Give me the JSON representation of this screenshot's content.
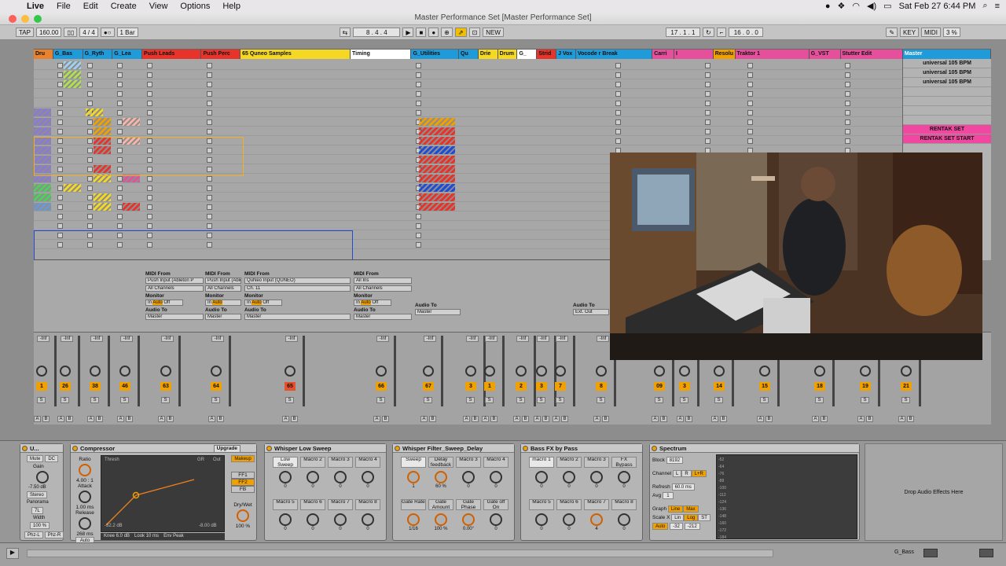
{
  "menubar": {
    "app": "Live",
    "items": [
      "File",
      "Edit",
      "Create",
      "View",
      "Options",
      "Help"
    ],
    "clock": "Sat Feb 27  6:44 PM"
  },
  "window": {
    "title": "Master Performance Set  [Master Performance Set]"
  },
  "transport": {
    "tap": "TAP",
    "tempo": "160.00",
    "signature": "4 / 4",
    "quant": "1 Bar",
    "position": "8 .  4 .  4",
    "new": "NEW",
    "loop_start": "17 .  1 .  1",
    "loop_len": "16 .  0 .  0",
    "key": "KEY",
    "midi": "MIDI",
    "cpu": "3 %"
  },
  "tracks": [
    {
      "name": "Dru",
      "color": "#e9822f"
    },
    {
      "name": "G_Bas",
      "color": "#1e9bd8"
    },
    {
      "name": "G_Ryth",
      "color": "#1e9bd8"
    },
    {
      "name": "G_Lea",
      "color": "#1e9bd8"
    },
    {
      "name": "Push Leads",
      "color": "#e8332b"
    },
    {
      "name": "Push Perc",
      "color": "#e8332b"
    },
    {
      "name": "65 Quneo Samples",
      "color": "#f4d823"
    },
    {
      "name": "Timing",
      "color": "#ffffff"
    },
    {
      "name": "G_Utilities",
      "color": "#1e9bd8"
    },
    {
      "name": "Qu",
      "color": "#1e9bd8"
    },
    {
      "name": "Drie",
      "color": "#f4d823"
    },
    {
      "name": "Drum",
      "color": "#f4d823"
    },
    {
      "name": "G_",
      "color": "#ffffff"
    },
    {
      "name": "Strid",
      "color": "#e8332b"
    },
    {
      "name": "J Vox",
      "color": "#1e9bd8"
    },
    {
      "name": "Vocode r Break",
      "color": "#1e9bd8"
    },
    {
      "name": "Carri",
      "color": "#e64f9c"
    },
    {
      "name": "I",
      "color": "#e64f9c"
    },
    {
      "name": "Resolu",
      "color": "#f0a000"
    },
    {
      "name": "Traktor 1",
      "color": "#e64f9c"
    },
    {
      "name": "G_VST",
      "color": "#e64f9c"
    },
    {
      "name": "Stutter Edit",
      "color": "#e64f9c"
    },
    {
      "name": "Master",
      "color": "#1e9bd8"
    }
  ],
  "master_scenes": [
    "universal 105 BPM",
    "universal 105 BPM",
    "universal 105 BPM",
    "",
    "",
    "",
    "",
    "RENTAK SET",
    "RENTAK SET START"
  ],
  "io": {
    "midi_from": "MIDI From",
    "audio_to": "Audio To",
    "monitor": "Monitor",
    "master": "Master",
    "in": "In",
    "auto": "Auto",
    "off": "Off",
    "push_input": "Push Input (Ableton P",
    "all_channels": "All Channels",
    "quneo_input": "QuNeo Input (QUNEO)",
    "ch11": "Ch. 11",
    "all_ins": "All Ins",
    "ext_out": "Ext. Out"
  },
  "mixer": {
    "numbers": [
      "1",
      "26",
      "38",
      "46",
      "63",
      "64",
      "65",
      "66",
      "67",
      "3",
      "1",
      "2",
      "3",
      "7",
      "8",
      "09",
      "3",
      "14",
      "15",
      "18",
      "19",
      "21"
    ],
    "solo": "S",
    "ab_a": "A",
    "ab_b": "B"
  },
  "devices": {
    "utility": {
      "title": "U...",
      "mute": "Mute",
      "dc": "DC",
      "gain": "Gain",
      "gain_val": "-7.50 dB",
      "stereo": "Stereo",
      "panorama": "Panorama",
      "pan_val": "7L",
      "width": "Width",
      "width_val": "100 %",
      "phzl": "Phz-L",
      "phzr": "Phz-R"
    },
    "compressor": {
      "title": "Compressor",
      "upgrade": "Upgrade",
      "makeup": "Makeup",
      "ratio": "Ratio",
      "ratio_val": "4.00 : 1",
      "attack": "Attack",
      "attack_val": "1.00 ms",
      "release": "Release",
      "release_val": "268 ms",
      "auto": "Auto",
      "thresh": "Thresh",
      "gr": "GR",
      "out": "Out",
      "left_db": "-32.2 dB",
      "right_db": "-8.00 dB",
      "knee": "Knee 6.0 dB",
      "look": "Look 10 ms",
      "env": "Env Peak",
      "ff1": "FF1",
      "ff2": "FF2",
      "fb": "FB",
      "drywet": "Dry/Wet",
      "drywet_val": "100 %"
    },
    "whisper_low": {
      "title": "Whisper Low Sweep",
      "macros": [
        "Low Sweep",
        "Macro 2",
        "Macro 3",
        "Macro 4",
        "Macro 5",
        "Macro 6",
        "Macro 7",
        "Macro 8"
      ],
      "values": [
        "0",
        "0",
        "0",
        "0",
        "0",
        "0",
        "0",
        "0"
      ]
    },
    "whisper_filter": {
      "title": "Whisper Filter_Sweep_Delay",
      "macros": [
        "Sweep",
        "Delay feedback",
        "Macro 3",
        "Macro 4",
        "Gate Rate",
        "Gate Amount",
        "Gate Phase",
        "Gate off On"
      ],
      "values": [
        "1",
        "60 %",
        "0",
        "0",
        "1/16",
        "100 %",
        "0.00°",
        "0"
      ]
    },
    "bass_fx": {
      "title": "Bass FX by Pass",
      "macros": [
        "macro 1",
        "Macro 2",
        "Macro 3",
        "FX Bypass",
        "Macro 5",
        "Macro 6",
        "Macro 7",
        "Macro 8"
      ],
      "values": [
        "0",
        "0",
        "0",
        "0",
        "0",
        "0",
        "4",
        "0"
      ]
    },
    "spectrum": {
      "title": "Spectrum",
      "block": "Block",
      "block_val": "8192",
      "channel": "Channel",
      "ch_l": "L",
      "ch_r": "R",
      "ch_lr": "L+R",
      "refresh": "Refresh",
      "refresh_val": "60.0 ms",
      "avg": "Avg",
      "avg_val": "1",
      "graph": "Graph",
      "line": "Line",
      "max": "Max",
      "scalex": "Scale X",
      "lin": "Lin",
      "log": "Log",
      "st": "ST",
      "auto": "Auto",
      "range_lo": "-32",
      "range_hi": "-212",
      "db_ticks": [
        "-52",
        "-64",
        "-76",
        "-88",
        "-100",
        "-112",
        "-124",
        "-136",
        "-148",
        "-160",
        "-172",
        "-184"
      ]
    },
    "drop": "Drop Audio Effects Here"
  },
  "status": {
    "track": "G_Bass"
  }
}
